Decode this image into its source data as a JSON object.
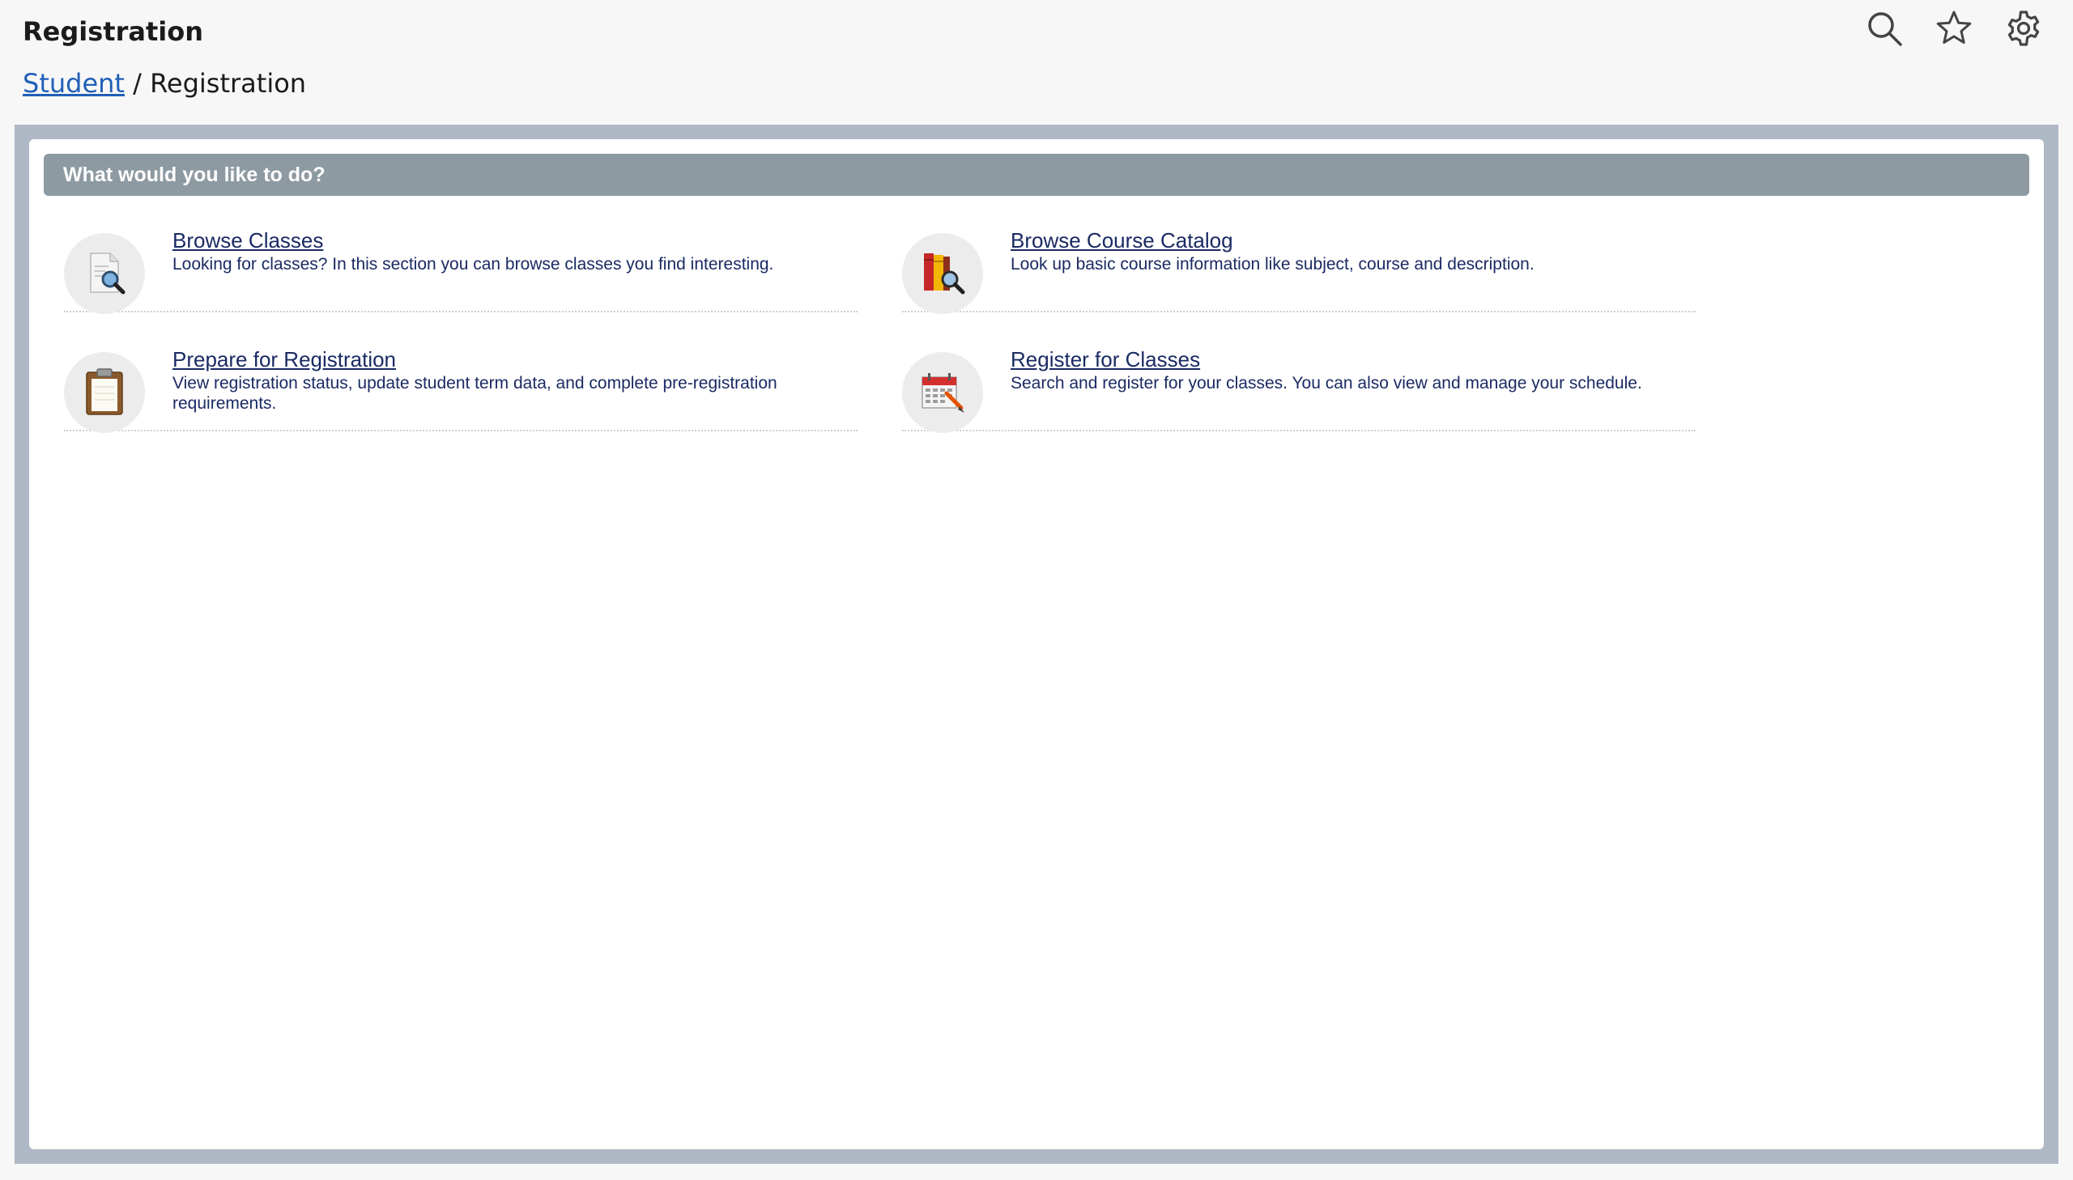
{
  "header": {
    "title": "Registration",
    "breadcrumb": {
      "parent": "Student",
      "separator": "/",
      "current": "Registration"
    },
    "icons": [
      "search-icon",
      "star-icon",
      "gear-icon"
    ]
  },
  "panel": {
    "heading": "What would you like to do?",
    "options": [
      {
        "label": "Browse Classes",
        "description": "Looking for classes? In this section you can browse classes you find interesting.",
        "icon": "document-search-icon"
      },
      {
        "label": "Browse Course Catalog",
        "description": "Look up basic course information like subject, course and description.",
        "icon": "book-search-icon"
      },
      {
        "label": "Prepare for Registration",
        "description": "View registration status, update student term data, and complete pre-registration requirements.",
        "icon": "clipboard-icon"
      },
      {
        "label": "Register for Classes",
        "description": "Search and register for your classes. You can also view and manage your schedule.",
        "icon": "calendar-pencil-icon"
      }
    ]
  },
  "colors": {
    "link": "#1a2a63",
    "breadcrumb_link": "#1f5fb8",
    "panel_header": "#8e9aa2",
    "frame": "#aeb9c5"
  }
}
